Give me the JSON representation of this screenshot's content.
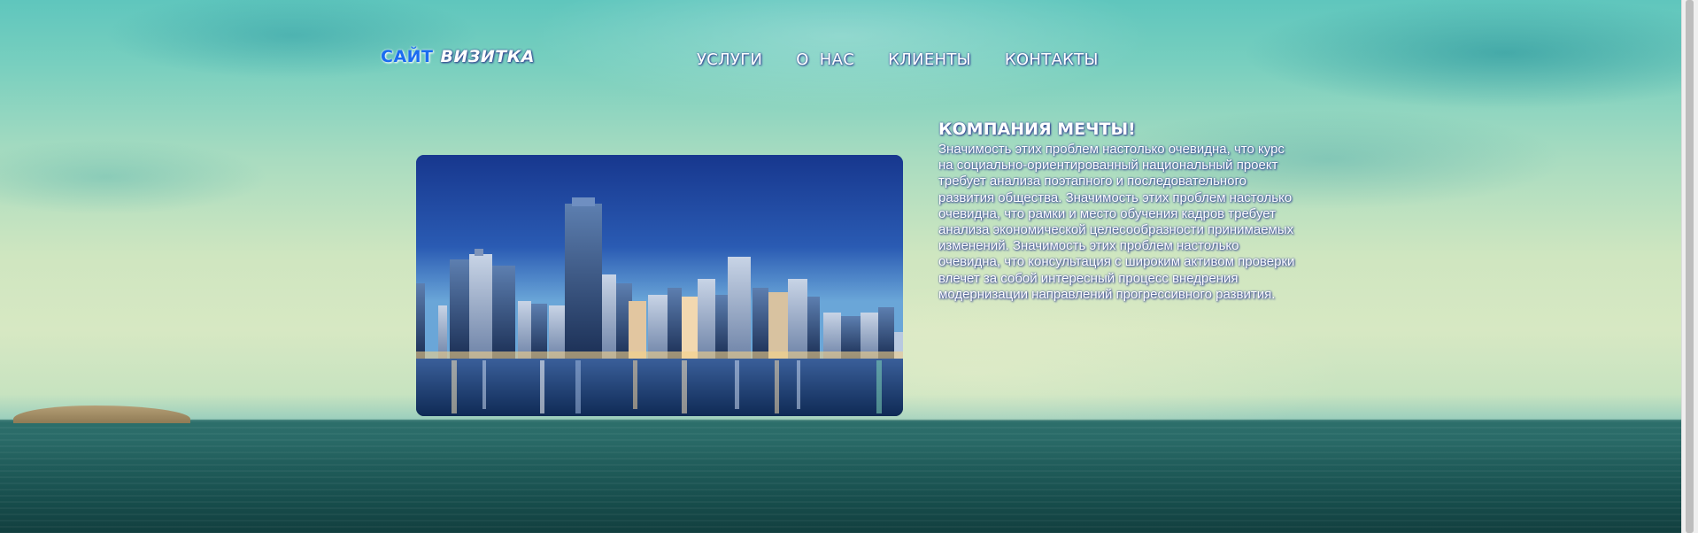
{
  "logo": {
    "part1": "САЙТ",
    "part2": "ВИЗИТКА"
  },
  "nav": {
    "items": [
      {
        "label": "УСЛУГИ"
      },
      {
        "label": "О  НАС"
      },
      {
        "label": "КЛИЕНТЫ"
      },
      {
        "label": "КОНТАКТЫ"
      }
    ]
  },
  "hero": {
    "image": "city-skyline-night-image"
  },
  "main": {
    "title": "КОМПАНИЯ МЕЧТЫ!",
    "text": "Значимость этих проблем настолько очевидна, что курс на социально-ориентированный национальный проект требует анализа поэтапного и последовательного развития общества. Значимость этих проблем настолько очевидна, что рамки и место обучения кадров требует анализа экономической целесообразности принимаемых изменений. Значимость этих проблем настолько очевидна, что консультация с широким активом проверки влечет за собой интересный процесс внедрения модернизации направлений прогрессивного развития."
  },
  "colors": {
    "logo_accent": "#1b6cf0",
    "text": "#ffffff",
    "text_shadow": "#2b3a8c"
  }
}
